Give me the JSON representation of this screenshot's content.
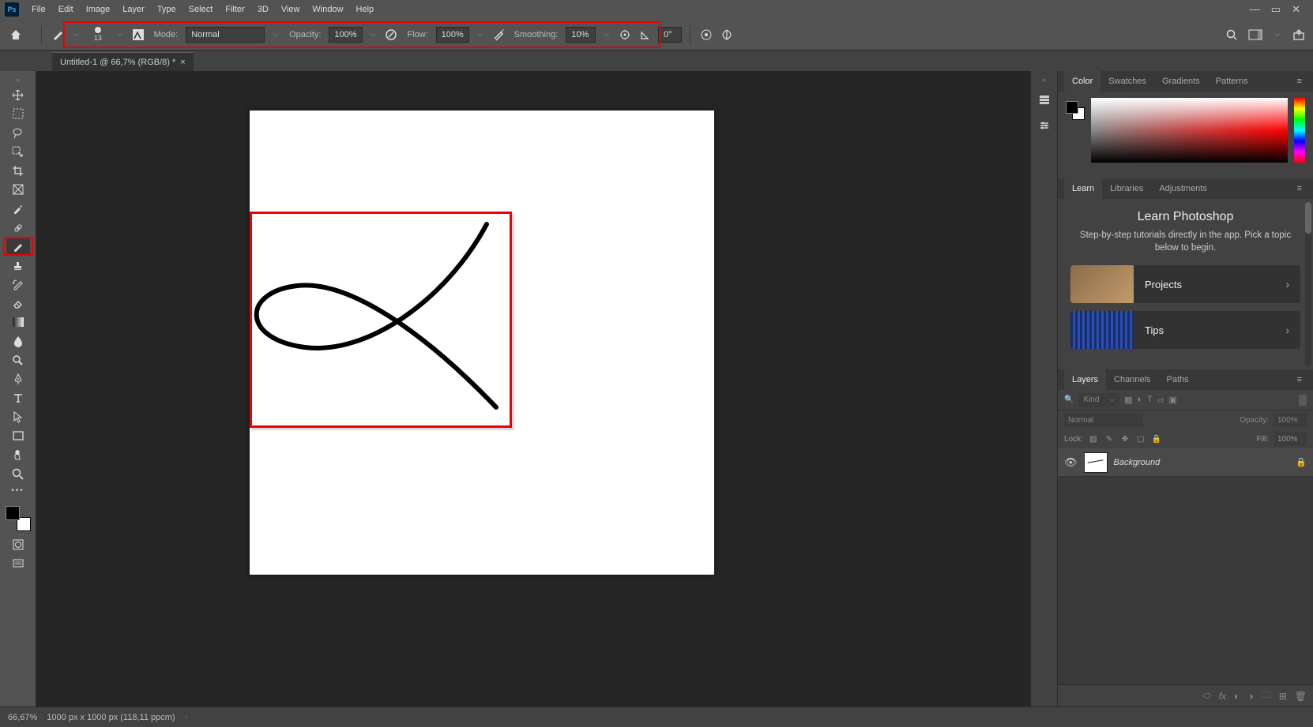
{
  "app_logo": "Ps",
  "menus": [
    "File",
    "Edit",
    "Image",
    "Layer",
    "Type",
    "Select",
    "Filter",
    "3D",
    "View",
    "Window",
    "Help"
  ],
  "options": {
    "brush_size": "13",
    "mode_label": "Mode:",
    "mode_value": "Normal",
    "opacity_label": "Opacity:",
    "opacity_value": "100%",
    "flow_label": "Flow:",
    "flow_value": "100%",
    "smoothing_label": "Smoothing:",
    "smoothing_value": "10%",
    "angle_value": "0°"
  },
  "tab": {
    "title": "Untitled-1 @ 66,7% (RGB/8) *"
  },
  "panels": {
    "color_tabs": [
      "Color",
      "Swatches",
      "Gradients",
      "Patterns"
    ],
    "learn_tabs": [
      "Learn",
      "Libraries",
      "Adjustments"
    ],
    "learn": {
      "title": "Learn Photoshop",
      "subtitle": "Step-by-step tutorials directly in the app. Pick a topic below to begin.",
      "cards": [
        {
          "label": "Projects"
        },
        {
          "label": "Tips"
        }
      ]
    },
    "layers_tabs": [
      "Layers",
      "Channels",
      "Paths"
    ],
    "layers": {
      "filter_label": "Kind",
      "blend_mode": "Normal",
      "opacity_label": "Opacity:",
      "opacity_value": "100%",
      "lock_label": "Lock:",
      "fill_label": "Fill:",
      "fill_value": "100%",
      "item_name": "Background"
    }
  },
  "status": {
    "zoom": "66,67%",
    "dims": "1000 px x 1000 px (118,11 ppcm)"
  }
}
